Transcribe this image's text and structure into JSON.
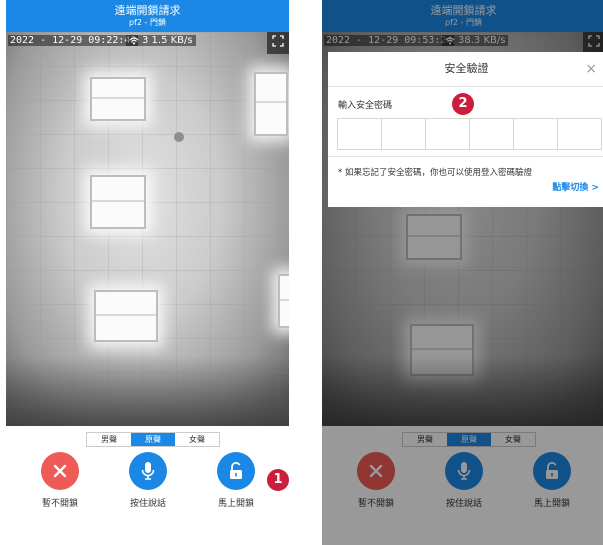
{
  "screens": [
    {
      "header": {
        "title": "遠端開鎖請求",
        "subtitle": "pf2 - 門鎖"
      },
      "video": {
        "timestamp": "2022 - 12-29 09:22:42",
        "rate": "3 1.5 KB/s"
      },
      "voice_options": [
        "男聲",
        "原聲",
        "女聲"
      ],
      "voice_selected": "原聲",
      "actions": {
        "reject": "暫不開鎖",
        "talk": "按住說話",
        "unlock": "馬上開鎖"
      },
      "step_marker": "1"
    },
    {
      "header": {
        "title": "遠端開鎖請求",
        "subtitle": "pf2 - 門鎖"
      },
      "video": {
        "timestamp": "2022 - 12-29 09:53:24",
        "rate": "38.3 KB/s"
      },
      "voice_options": [
        "男聲",
        "原聲",
        "女聲"
      ],
      "voice_selected": "原聲",
      "actions": {
        "reject": "暫不開鎖",
        "talk": "按住說話",
        "unlock": "馬上開鎖"
      },
      "dialog": {
        "title": "安全驗證",
        "label": "輸入安全密碼",
        "pin_length": 6,
        "hint": "* 如果忘記了安全密碼，你也可以使用登入密碼驗證",
        "switch_link": "點擊切換 >",
        "close_glyph": "×"
      },
      "step_marker": "2"
    }
  ],
  "colors": {
    "primary": "#1b88e6",
    "danger": "#ee5a56",
    "marker": "#cc1e3c"
  },
  "icons": [
    "close-icon",
    "microphone-icon",
    "unlock-icon",
    "wifi-icon",
    "fullscreen-icon"
  ]
}
